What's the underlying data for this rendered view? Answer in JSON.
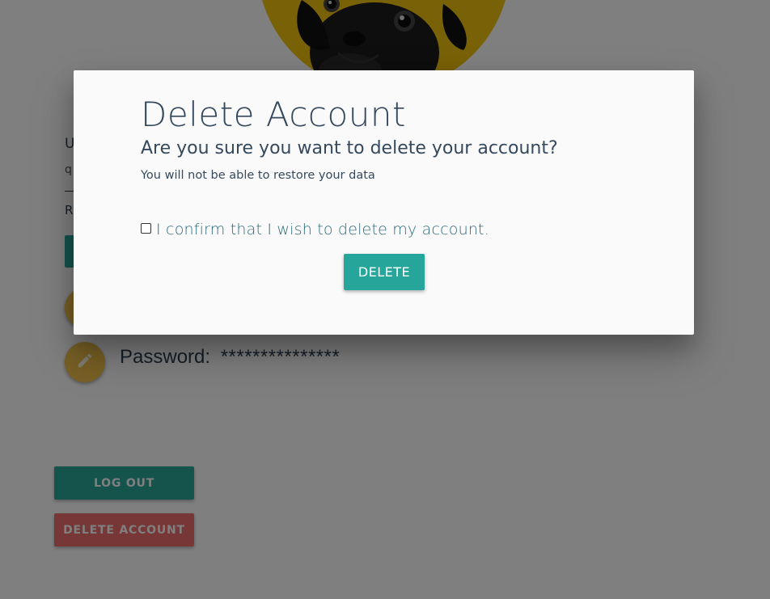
{
  "profile": {
    "label_u": "U",
    "label_q": "q",
    "label_r": "R",
    "password_label": "Password:",
    "password_value": "***************"
  },
  "buttons": {
    "logout_label": "LOG OUT",
    "delete_account_label": "DELETE ACCOUNT"
  },
  "modal": {
    "title": "Delete Account",
    "question": "Are you sure you want to delete your account?",
    "warning": "You will not be able to restore your data",
    "confirm_label": "I confirm that I wish to delete my account.",
    "confirm_checked": false,
    "delete_label": "DELETE"
  },
  "colors": {
    "teal": "#26a69a",
    "red": "#ee6e6e",
    "avatar_bg": "#f2c30f",
    "edit_fab": "#f0c14b",
    "text": "#35495e"
  },
  "icons": {
    "edit": "pencil-icon",
    "avatar": "pug-avatar"
  }
}
